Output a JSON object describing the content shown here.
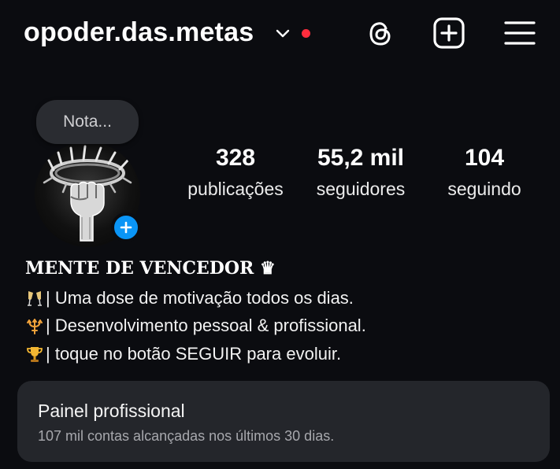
{
  "header": {
    "username": "opoder.das.metas",
    "icons": {
      "account_switcher": "chevron-down-icon",
      "notification_dot": "red-dot",
      "threads": "threads-icon",
      "create": "plus-square-icon",
      "menu": "hamburger-menu-icon"
    }
  },
  "note": {
    "placeholder": "Nota..."
  },
  "profile": {
    "avatar_icon": "crowned-fist-avatar",
    "add_story_icon": "plus-icon"
  },
  "stats": {
    "posts": {
      "value": "328",
      "label": "publicações"
    },
    "followers": {
      "value": "55,2 mil",
      "label": "seguidores"
    },
    "following": {
      "value": "104",
      "label": "seguindo"
    }
  },
  "bio": {
    "name": "MENTE DE VENCEDOR ♛",
    "lines": [
      {
        "icon": "champagne-glasses-icon",
        "text": "| Uma dose de motivação todos os dias."
      },
      {
        "icon": "trident-icon",
        "text": "| Desenvolvimento pessoal & profissional."
      },
      {
        "icon": "trophy-icon",
        "text": "| toque no botão SEGUIR para evoluir."
      }
    ]
  },
  "professional_dashboard": {
    "title": "Painel profissional",
    "subtitle": "107 mil contas alcançadas nos últimos 30 dias."
  },
  "colors": {
    "background": "#0b0c10",
    "panel": "#24262b",
    "accent_blue": "#0a95f6",
    "notification_red": "#ff2d3d"
  }
}
